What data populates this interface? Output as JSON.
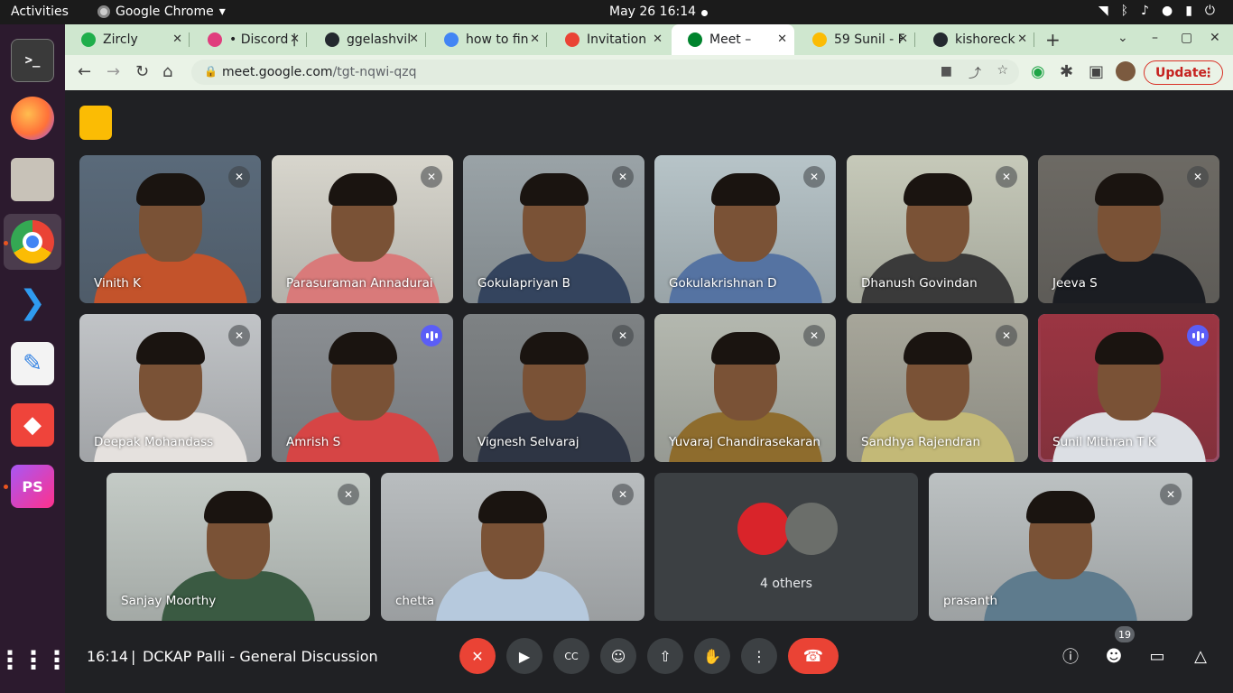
{
  "system": {
    "activities": "Activities",
    "app_name": "Google Chrome",
    "app_menu_arrow": "▾",
    "clock": "May 26  16:14",
    "tray_icons": [
      "wifi-icon",
      "bluetooth-icon",
      "volume-icon",
      "mic-icon",
      "battery-icon",
      "power-icon"
    ]
  },
  "dock": {
    "items": [
      "terminal",
      "firefox",
      "files",
      "chrome",
      "vscode",
      "text-editor",
      "anydesk",
      "phpstorm",
      "show-apps"
    ],
    "labels": {
      "terminal": ">_",
      "phpstorm": "PS"
    }
  },
  "browser": {
    "tabs": [
      {
        "title": "Zircly",
        "color": "#1fae4b"
      },
      {
        "title": "• Discord |",
        "color": "#e03d7d"
      },
      {
        "title": "ggelashvil",
        "color": "#24292f"
      },
      {
        "title": "how to fin",
        "color": "#4285f4"
      },
      {
        "title": "Invitation",
        "color": "#ea4335"
      },
      {
        "title": "Meet –",
        "color": "#00832d"
      },
      {
        "title": "59 Sunil - F",
        "color": "#fbbc04"
      },
      {
        "title": "kishoreck",
        "color": "#24292f"
      }
    ],
    "new_tab": "+",
    "url_host": "meet.google.com",
    "url_path": "/tgt-nqwi-qzq",
    "update_label": "Update"
  },
  "meet": {
    "participants": [
      {
        "name": "Vinith K",
        "muted": true,
        "bg": "#5a6a7a",
        "shirt": "#c3532b"
      },
      {
        "name": "Parasuraman Annadurai",
        "muted": true,
        "bg": "#d8d6cd",
        "shirt": "#d97a7a"
      },
      {
        "name": "Gokulapriyan B",
        "muted": true,
        "bg": "#9aa3a7",
        "shirt": "#34445e"
      },
      {
        "name": "Gokulakrishnan D",
        "muted": true,
        "bg": "#b7c4c8",
        "shirt": "#5573a2"
      },
      {
        "name": "Dhanush Govindan",
        "muted": true,
        "bg": "#c6c9b9",
        "shirt": "#3a3a3a"
      },
      {
        "name": "Jeeva S",
        "muted": true,
        "bg": "#6d6a64",
        "shirt": "#1b1d22"
      },
      {
        "name": "Deepak Mohandass",
        "muted": true,
        "bg": "#c1c4c7",
        "shirt": "#e5e1de"
      },
      {
        "name": "Amrish S",
        "muted": false,
        "bg": "#8b8f93",
        "shirt": "#d64545"
      },
      {
        "name": "Vignesh Selvaraj",
        "muted": true,
        "bg": "#7e8284",
        "shirt": "#2e3544"
      },
      {
        "name": "Yuvaraj Chandirasekaran",
        "muted": true,
        "bg": "#b4b8af",
        "shirt": "#8e6c2d"
      },
      {
        "name": "Sandhya Rajendran",
        "muted": true,
        "bg": "#a7a69a",
        "shirt": "#c3b977"
      },
      {
        "name": "Sunil Mithran T K",
        "muted": false,
        "bg": "#9b3542",
        "shirt": "#dcdfe4",
        "highlight": true
      },
      {
        "name": "Sanjay Moorthy",
        "muted": true,
        "bg": "#c4cbc6",
        "shirt": "#3a5a42"
      },
      {
        "name": "chetta",
        "muted": true,
        "bg": "#b9bdbf",
        "shirt": "#b6c9dd"
      },
      {
        "name": "prasanth",
        "muted": true,
        "bg": "#bcc1c2",
        "shirt": "#5e7b8d"
      }
    ],
    "others_label": "4 others",
    "time": "16:14",
    "separator": "|",
    "meeting_title": "DCKAP Palli - General Discussion",
    "people_count": "19"
  }
}
